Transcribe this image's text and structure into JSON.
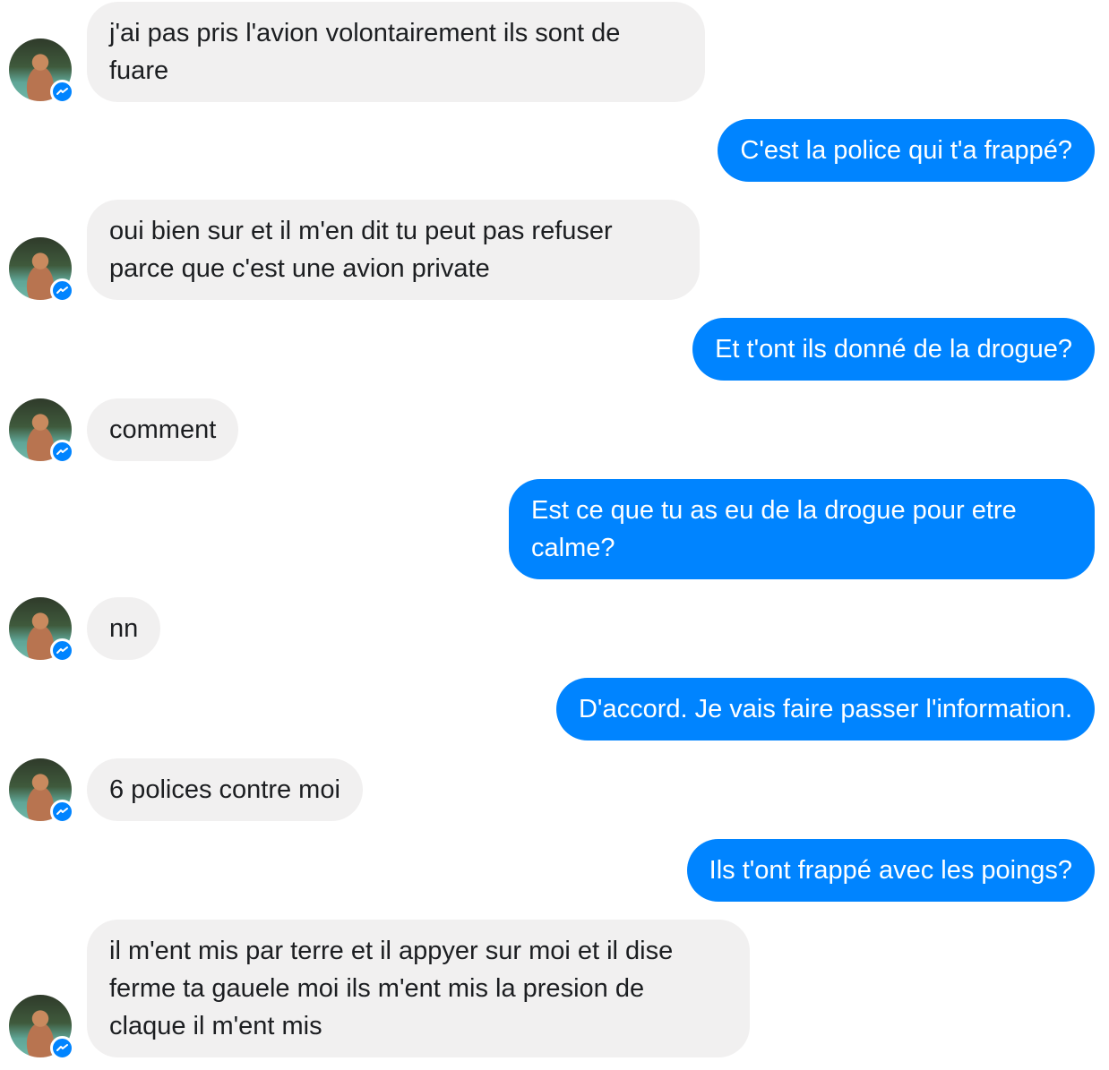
{
  "messages": [
    {
      "sender": "them",
      "text": "j'ai pas pris l'avion volontairement ils sont de fuare"
    },
    {
      "sender": "me",
      "text": "C'est la police qui t'a frappé?"
    },
    {
      "sender": "them",
      "text": "oui bien sur et il m'en dit tu peut pas refuser parce que c'est une avion private"
    },
    {
      "sender": "me",
      "text": "Et t'ont ils donné de la drogue?"
    },
    {
      "sender": "them",
      "text": "comment"
    },
    {
      "sender": "me",
      "text": "Est ce que tu as eu de la drogue pour etre calme?"
    },
    {
      "sender": "them",
      "text": "nn"
    },
    {
      "sender": "me",
      "text": "D'accord. Je vais faire passer l'information."
    },
    {
      "sender": "them",
      "text": "6 polices contre moi"
    },
    {
      "sender": "me",
      "text": "Ils t'ont frappé avec les poings?"
    },
    {
      "sender": "them",
      "text": "il m'ent mis par terre et il appyer sur moi et il dise ferme ta gauele moi ils m'ent mis la presion de claque il m'ent mis"
    }
  ],
  "theme": {
    "incoming_bubble": "#f1f0f0",
    "outgoing_bubble": "#0084ff",
    "badge": "messenger-badge-icon"
  }
}
